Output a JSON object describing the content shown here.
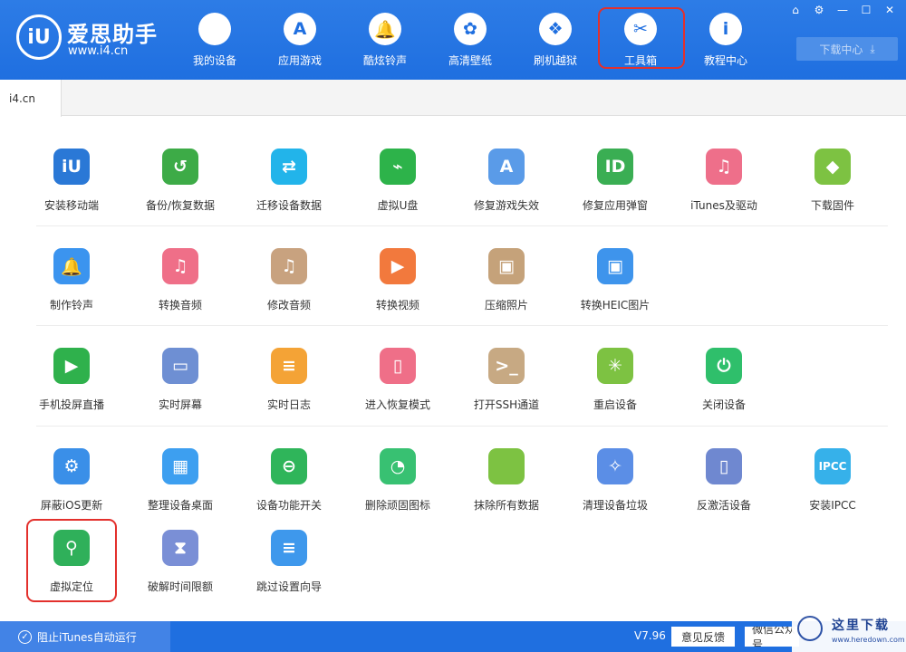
{
  "app": {
    "logo_mark": "iU",
    "logo_name": "爱思助手",
    "logo_url": "www.i4.cn",
    "accent": "#1f6fe0"
  },
  "nav": [
    {
      "label": "我的设备",
      "icon": "apple-icon",
      "glyph": "",
      "active": false
    },
    {
      "label": "应用游戏",
      "icon": "app-store-icon",
      "glyph": "A",
      "active": false
    },
    {
      "label": "酷炫铃声",
      "icon": "bell-icon",
      "glyph": "🔔",
      "active": false
    },
    {
      "label": "高清壁纸",
      "icon": "flower-icon",
      "glyph": "✿",
      "active": false
    },
    {
      "label": "刷机越狱",
      "icon": "dropbox-icon",
      "glyph": "❖",
      "active": false
    },
    {
      "label": "工具箱",
      "icon": "tools-icon",
      "glyph": "✂",
      "active": true
    },
    {
      "label": "教程中心",
      "icon": "info-icon",
      "glyph": "i",
      "active": false
    }
  ],
  "window_controls": [
    "⌂",
    "⚙",
    "—",
    "☐",
    "✕"
  ],
  "download_center": {
    "label": "下载中心",
    "icon": "download-icon",
    "glyph": "⤓"
  },
  "tab": {
    "label": "i4.cn"
  },
  "tools": [
    [
      {
        "label": "安装移动端",
        "icon": "i4-mobile-icon",
        "glyph": "iU",
        "color": "#2a78d6"
      },
      {
        "label": "备份/恢复数据",
        "icon": "backup-clock-icon",
        "glyph": "↺",
        "color": "#3dab47"
      },
      {
        "label": "迁移设备数据",
        "icon": "transfer-phones-icon",
        "glyph": "⇄",
        "color": "#22b4ea"
      },
      {
        "label": "虚拟U盘",
        "icon": "usb-drive-icon",
        "glyph": "⌁",
        "color": "#2db34a"
      },
      {
        "label": "修复游戏失效",
        "icon": "app-repair-icon",
        "glyph": "A",
        "color": "#5a9be8"
      },
      {
        "label": "修复应用弹窗",
        "icon": "apple-id-icon",
        "glyph": "ID",
        "color": "#3aae53"
      },
      {
        "label": "iTunes及驱动",
        "icon": "itunes-icon",
        "glyph": "♫",
        "color": "#ee6f8a"
      },
      {
        "label": "下载固件",
        "icon": "firmware-box-icon",
        "glyph": "◆",
        "color": "#7dc242"
      }
    ],
    [
      {
        "label": "制作铃声",
        "icon": "ringtone-bell-icon",
        "glyph": "🔔",
        "color": "#3b94ef"
      },
      {
        "label": "转换音频",
        "icon": "audio-convert-icon",
        "glyph": "♫",
        "color": "#ef6f88"
      },
      {
        "label": "修改音频",
        "icon": "audio-edit-icon",
        "glyph": "♫",
        "color": "#c8a27f"
      },
      {
        "label": "转换视频",
        "icon": "video-convert-icon",
        "glyph": "▶",
        "color": "#f2793d"
      },
      {
        "label": "压缩照片",
        "icon": "photo-compress-icon",
        "glyph": "▣",
        "color": "#c5a27a"
      },
      {
        "label": "转换HEIC图片",
        "icon": "heic-convert-icon",
        "glyph": "▣",
        "color": "#3e94ec"
      }
    ],
    [
      {
        "label": "手机投屏直播",
        "icon": "screen-cast-icon",
        "glyph": "▶",
        "color": "#2fb14c"
      },
      {
        "label": "实时屏幕",
        "icon": "monitor-icon",
        "glyph": "▭",
        "color": "#6e8fd3"
      },
      {
        "label": "实时日志",
        "icon": "log-file-icon",
        "glyph": "≡",
        "color": "#f4a336"
      },
      {
        "label": "进入恢复模式",
        "icon": "recovery-phone-icon",
        "glyph": "▯",
        "color": "#ef6f88"
      },
      {
        "label": "打开SSH通道",
        "icon": "ssh-terminal-icon",
        "glyph": ">_",
        "color": "#c7a983"
      },
      {
        "label": "重启设备",
        "icon": "restart-icon",
        "glyph": "✳",
        "color": "#7dc242"
      },
      {
        "label": "关闭设备",
        "icon": "power-icon",
        "glyph": "⏻",
        "color": "#2fbf6b"
      }
    ],
    [
      {
        "label": "屏蔽iOS更新",
        "icon": "block-update-gear-icon",
        "glyph": "⚙",
        "color": "#3a8fe8"
      },
      {
        "label": "整理设备桌面",
        "icon": "desktop-grid-icon",
        "glyph": "▦",
        "color": "#3d9ff0"
      },
      {
        "label": "设备功能开关",
        "icon": "toggle-switch-icon",
        "glyph": "⊖",
        "color": "#2fb55a"
      },
      {
        "label": "删除顽固图标",
        "icon": "delete-icon-pie-icon",
        "glyph": "◔",
        "color": "#38c172"
      },
      {
        "label": "抹除所有数据",
        "icon": "erase-apple-icon",
        "glyph": "",
        "color": "#7dc242"
      },
      {
        "label": "清理设备垃圾",
        "icon": "broom-icon",
        "glyph": "✧",
        "color": "#5b8ee6"
      },
      {
        "label": "反激活设备",
        "icon": "deactivate-tablet-icon",
        "glyph": "▯",
        "color": "#6f88d0"
      },
      {
        "label": "安装IPCC",
        "icon": "ipcc-icon",
        "glyph": "IPCC",
        "color": "#36b1ea"
      }
    ],
    [
      {
        "label": "虚拟定位",
        "icon": "location-pin-icon",
        "glyph": "⚲",
        "color": "#2fb05a"
      },
      {
        "label": "破解时间限额",
        "icon": "hourglass-icon",
        "glyph": "⧗",
        "color": "#7a8fd6"
      },
      {
        "label": "跳过设置向导",
        "icon": "skip-setup-icon",
        "glyph": "≡",
        "color": "#3e98ec"
      }
    ]
  ],
  "statusbar": {
    "itunes_toggle": "阻止iTunes自动运行",
    "version": "V7.96",
    "feedback": "意见反馈",
    "wechat": "微信公众号"
  },
  "watermark": {
    "text": "这里下载",
    "url": "www.heredown.com"
  }
}
